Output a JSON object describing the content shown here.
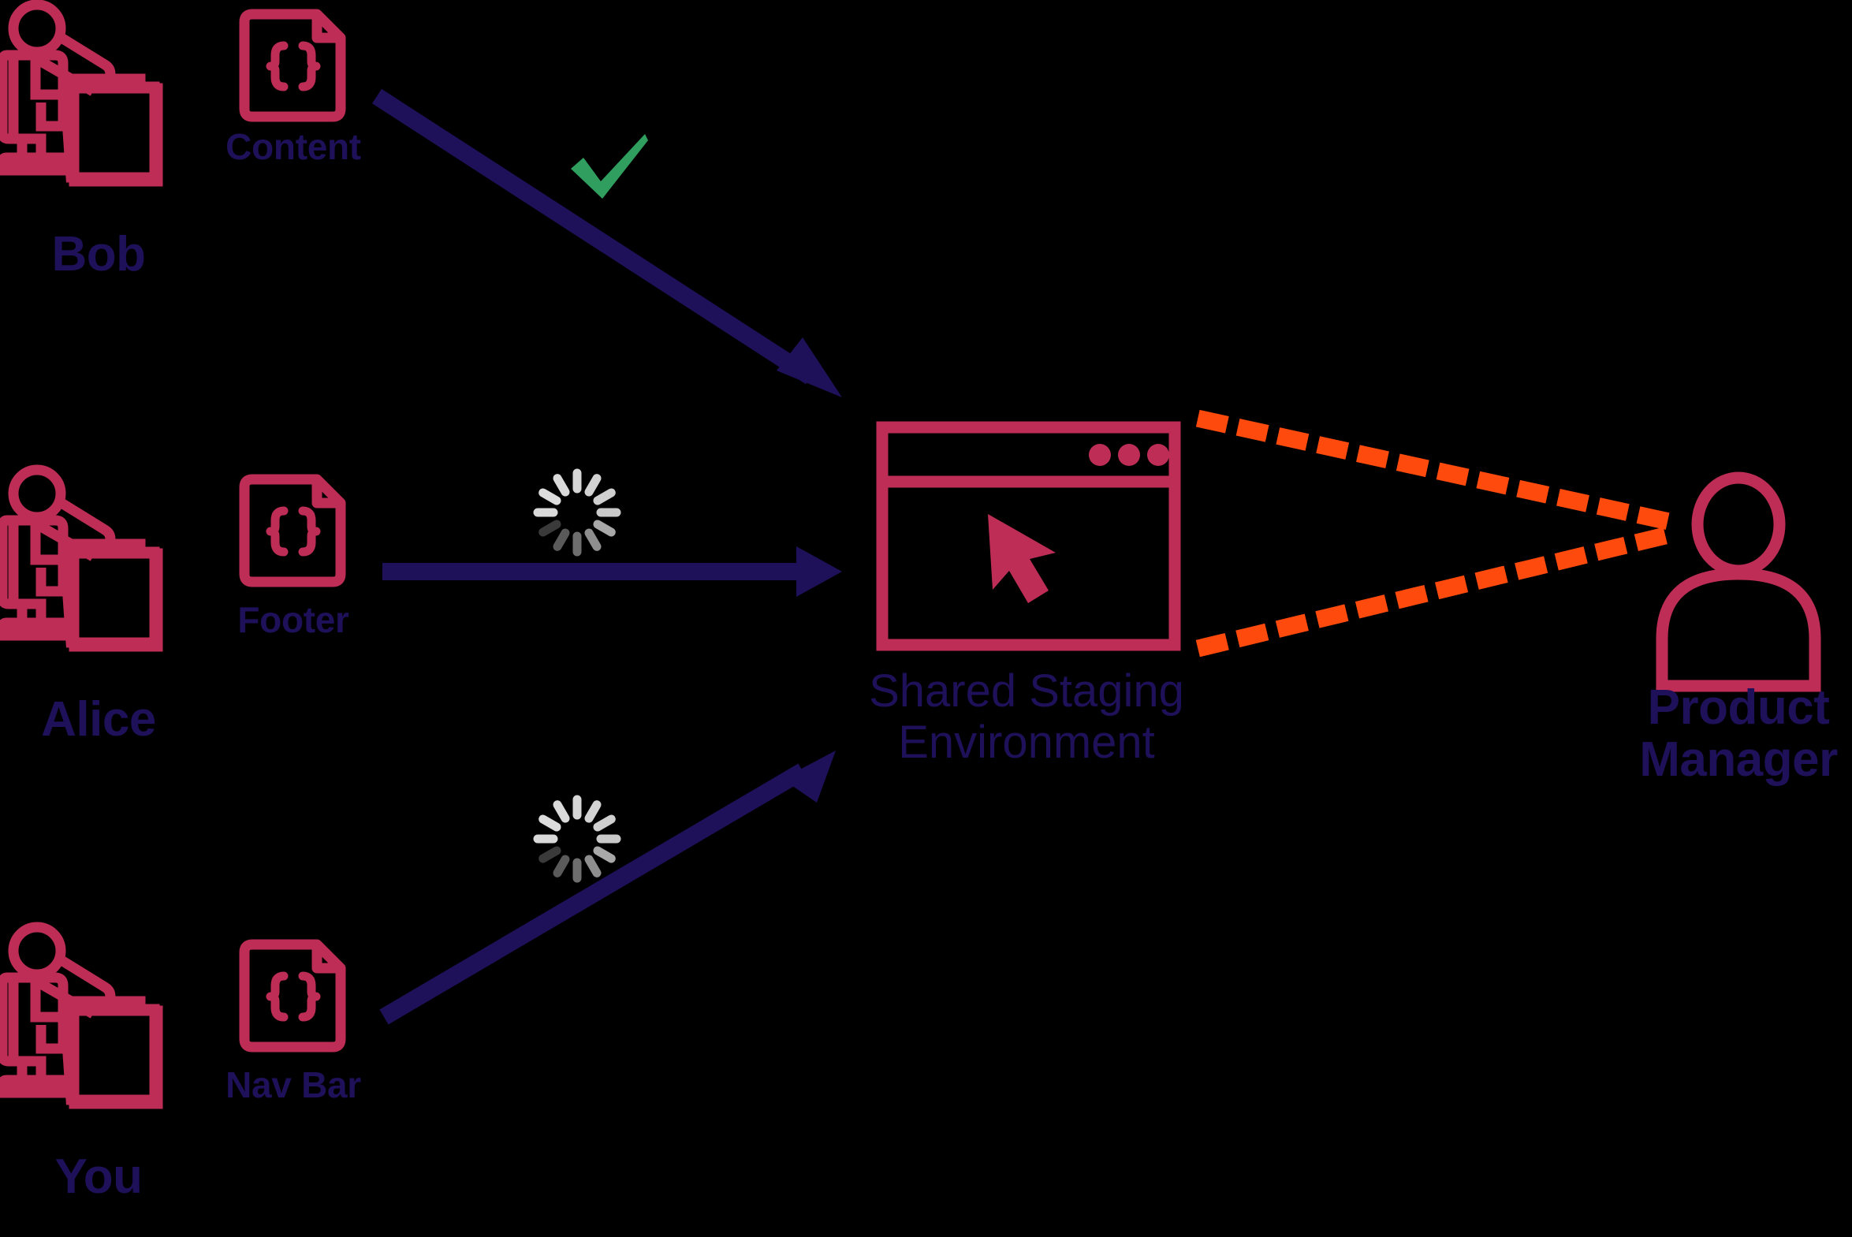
{
  "diagram": {
    "title": "Shared Staging Environment collaboration diagram",
    "background_color": "#000000",
    "palette": {
      "crimson": "#BE2D56",
      "navy": "#1E1159",
      "green": "#2F9E5F",
      "orange": "#FF4A0D",
      "spinner_light": "#D4D4D4",
      "spinner_dark": "#3A3A3A"
    },
    "developers": [
      {
        "id": "bob",
        "name": "Bob",
        "icon": "developer-at-desk-icon",
        "file": {
          "label": "Content",
          "icon": "code-file-icon",
          "glyph": "{}"
        },
        "status": {
          "type": "check",
          "icon": "green-check-icon",
          "color": "#2F9E5F"
        },
        "arrow": {
          "icon": "arrow-icon",
          "color": "#1E1159",
          "direction": "down-right"
        }
      },
      {
        "id": "alice",
        "name": "Alice",
        "icon": "developer-at-desk-icon",
        "file": {
          "label": "Footer",
          "icon": "code-file-icon",
          "glyph": "{}"
        },
        "status": {
          "type": "spinner",
          "icon": "loading-spinner-icon",
          "color": "#D4D4D4"
        },
        "arrow": {
          "icon": "arrow-icon",
          "color": "#1E1159",
          "direction": "right"
        }
      },
      {
        "id": "you",
        "name": "You",
        "icon": "developer-at-desk-icon",
        "file": {
          "label": "Nav Bar",
          "icon": "code-file-icon",
          "glyph": "{}"
        },
        "status": {
          "type": "spinner",
          "icon": "loading-spinner-icon",
          "color": "#D4D4D4"
        },
        "arrow": {
          "icon": "arrow-icon",
          "color": "#1E1159",
          "direction": "up-right"
        }
      }
    ],
    "hub": {
      "label": "Shared Staging\nEnvironment",
      "icon": "browser-window-icon",
      "cursor_icon": "mouse-cursor-icon",
      "window_dots": 3,
      "color": "#BE2D56"
    },
    "stakeholder": {
      "label": "Product\nManager",
      "icon": "person-icon",
      "color": "#BE2D56",
      "connection": {
        "icon": "dotted-line-icon",
        "style": "dotted",
        "color": "#FF4A0D",
        "count": 2
      }
    }
  }
}
